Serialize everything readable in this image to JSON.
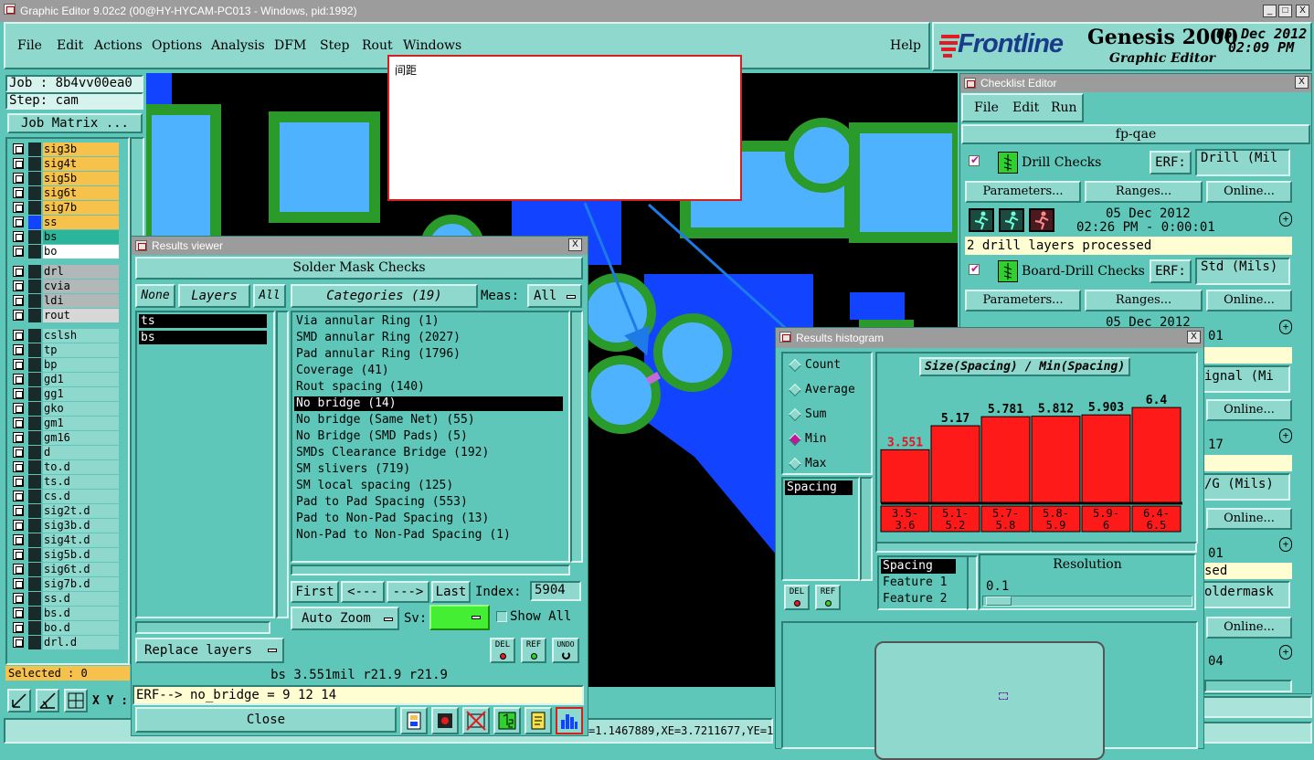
{
  "window": {
    "title": "Graphic Editor 9.02c2 (00@HY-HYCAM-PC013 - Windows, pid:1992)",
    "min_label": "_",
    "max_label": "□",
    "close_label": "X"
  },
  "menu": {
    "items": [
      "File",
      "Edit",
      "Actions",
      "Options",
      "Analysis",
      "DFM",
      "Step",
      "Rout",
      "Windows"
    ],
    "help": "Help"
  },
  "brand": {
    "logo": "Frontline",
    "product": "Genesis 2000",
    "subtitle": "Graphic Editor",
    "date": "05 Dec 2012",
    "time": "02:09 PM"
  },
  "job": {
    "job_label": "Job : 8b4vv00ea0",
    "step_label": "Step: cam",
    "matrix_button": "Job Matrix ..."
  },
  "layers": [
    {
      "name": "sig3b",
      "color": "#f6c24b"
    },
    {
      "name": "sig4t",
      "color": "#f6c24b"
    },
    {
      "name": "sig5b",
      "color": "#f6c24b"
    },
    {
      "name": "sig6t",
      "color": "#f6c24b"
    },
    {
      "name": "sig7b",
      "color": "#f6c24b"
    },
    {
      "name": "ss",
      "color": "#f6c24b"
    },
    {
      "name": "bs",
      "color": "#2bb59a"
    },
    {
      "name": "bo",
      "color": "#ffffff"
    },
    {
      "name": "drl",
      "color": "#b2b8b8"
    },
    {
      "name": "cvia",
      "color": "#b2b8b8"
    },
    {
      "name": "ldi",
      "color": "#b2b8b8"
    },
    {
      "name": "rout",
      "color": "#d7d7d7"
    },
    {
      "name": "cslsh",
      "color": "#8fd8cd"
    },
    {
      "name": "tp",
      "color": "#8fd8cd"
    },
    {
      "name": "bp",
      "color": "#8fd8cd"
    },
    {
      "name": "gd1",
      "color": "#8fd8cd"
    },
    {
      "name": "gg1",
      "color": "#8fd8cd"
    },
    {
      "name": "gko",
      "color": "#8fd8cd"
    },
    {
      "name": "gm1",
      "color": "#8fd8cd"
    },
    {
      "name": "gm16",
      "color": "#8fd8cd"
    },
    {
      "name": "d",
      "color": "#8fd8cd"
    },
    {
      "name": "to.d",
      "color": "#8fd8cd"
    },
    {
      "name": "ts.d",
      "color": "#8fd8cd"
    },
    {
      "name": "cs.d",
      "color": "#8fd8cd"
    },
    {
      "name": "sig2t.d",
      "color": "#8fd8cd"
    },
    {
      "name": "sig3b.d",
      "color": "#8fd8cd"
    },
    {
      "name": "sig4t.d",
      "color": "#8fd8cd"
    },
    {
      "name": "sig5b.d",
      "color": "#8fd8cd"
    },
    {
      "name": "sig6t.d",
      "color": "#8fd8cd"
    },
    {
      "name": "sig7b.d",
      "color": "#8fd8cd"
    },
    {
      "name": "ss.d",
      "color": "#8fd8cd"
    },
    {
      "name": "bs.d",
      "color": "#8fd8cd"
    },
    {
      "name": "bo.d",
      "color": "#8fd8cd"
    },
    {
      "name": "drl.d",
      "color": "#8fd8cd"
    }
  ],
  "selected_label": "Selected : 0",
  "xy_label": "X Y :",
  "coords_text": "=1.1467889,XE=3.7211677,YE=1.",
  "note": {
    "text": "间距"
  },
  "results_viewer": {
    "title": "Results viewer",
    "heading": "Solder Mask Checks",
    "none": "None",
    "layers": "Layers",
    "all": "All",
    "categories_label": "Categories (19)",
    "meas_label": "Meas:",
    "meas_value": "All",
    "layer_list": [
      "ts",
      "bs"
    ],
    "categories": [
      "Via annular Ring (1)",
      "SMD annular Ring (2027)",
      "Pad annular Ring (1796)",
      "Coverage (41)",
      "Rout spacing (140)",
      "No bridge (14)",
      "No bridge (Same Net) (55)",
      "No Bridge (SMD Pads) (5)",
      "SMDs Clearance Bridge (192)",
      "SM slivers (719)",
      "SM local spacing (125)",
      "Pad to Pad Spacing (553)",
      "Pad to Non-Pad Spacing (13)",
      "Non-Pad to Non-Pad Spacing (1)"
    ],
    "selected_index": 5,
    "first": "First",
    "prev": "<---",
    "next": "--->",
    "last": "Last",
    "index_label": "Index:",
    "index_value": "5904",
    "auto_zoom": "Auto Zoom",
    "sv_label": "Sv:",
    "show_all": "Show All",
    "replace_layers": "Replace layers",
    "del": "DEL",
    "ref": "REF",
    "undo": "UNDO",
    "status": "bs 3.551mil   r21.9   r21.9",
    "erf": "ERF--> no_bridge = 9 12 14",
    "close": "Close"
  },
  "checklist": {
    "title": "Checklist Editor",
    "menu": [
      "File",
      "Edit",
      "Run"
    ],
    "name": "fp-qae",
    "checks": [
      {
        "title": "Drill Checks",
        "erf": "ERF:",
        "erf_value": "Drill (Mil",
        "params": "Parameters...",
        "ranges": "Ranges...",
        "online": "Online...",
        "date": "05 Dec 2012",
        "time": "02:26 PM - 0:00:01",
        "status": "2 drill layers processed"
      },
      {
        "title": "Board-Drill Checks",
        "erf": "ERF:",
        "erf_value": "Std (Mils)",
        "params": "Parameters...",
        "ranges": "Ranges...",
        "online": "Online...",
        "date": "05 Dec 2012",
        "time": "01"
      }
    ],
    "right_fragments": [
      "ignal (Mi",
      "Online...",
      "17",
      "/G (Mils)",
      "Online...",
      "01",
      "sed",
      "oldermask",
      "Online...",
      "04"
    ]
  },
  "histogram": {
    "title": "Results histogram",
    "modes": [
      "Count",
      "Average",
      "Sum",
      "Min",
      "Max"
    ],
    "selected_mode": "Min",
    "chart_title": "Size(Spacing) / Min(Spacing)",
    "list": [
      "Spacing"
    ],
    "del": "DEL",
    "ref": "REF",
    "fields": [
      "Spacing",
      "Feature 1",
      "Feature 2"
    ],
    "resolution_label": "Resolution",
    "resolution_value": "0.1"
  },
  "chart_data": {
    "type": "bar",
    "title": "Size(Spacing) / Min(Spacing)",
    "categories": [
      "3.5-3.6",
      "5.1-5.2",
      "5.7-5.8",
      "5.8-5.9",
      "5.9-6",
      "6.4-6.5"
    ],
    "values": [
      3.551,
      5.17,
      5.781,
      5.812,
      5.903,
      6.4
    ],
    "value_labels": [
      "3.551",
      "5.17",
      "5.781",
      "5.812",
      "5.903",
      "6.4"
    ],
    "bin_labels": [
      [
        "3.5-",
        "3.6"
      ],
      [
        "5.1-",
        "5.2"
      ],
      [
        "5.7-",
        "5.8"
      ],
      [
        "5.8-",
        "5.9"
      ],
      [
        "5.9-",
        "6"
      ],
      [
        "6.4-",
        "6.5"
      ]
    ],
    "highlight_index": 0,
    "bar_color": "#ff1a1a",
    "highlight_label_color": "#e8121e",
    "ylim": [
      0,
      6.9
    ]
  }
}
